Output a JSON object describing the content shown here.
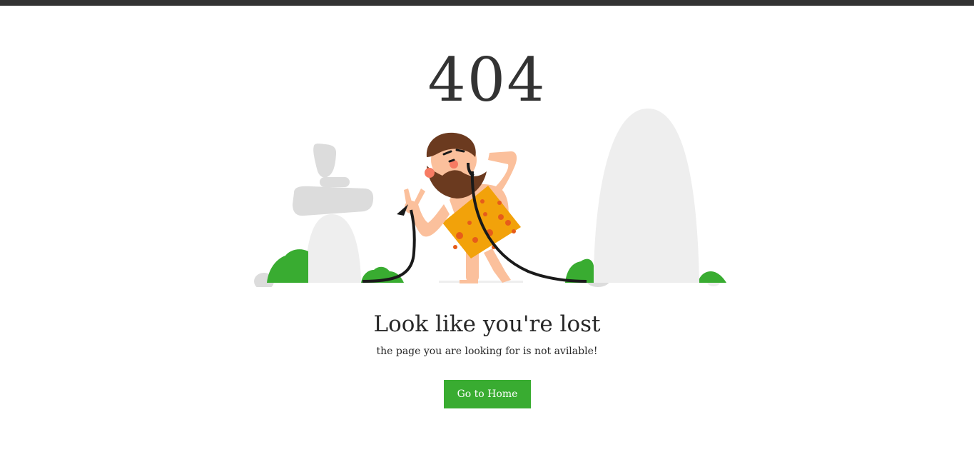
{
  "error": {
    "code": "404",
    "headline": "Look like you're lost",
    "message": "the page you are looking for is not avilable!"
  },
  "actions": {
    "home_label": "Go to Home"
  },
  "colors": {
    "top_bar": "#333333",
    "text": "#262626",
    "button": "#39ac31",
    "button_text": "#ffffff",
    "rock": "#eeeeee",
    "bush": "#39ac31",
    "loincloth": "#f2a20a"
  }
}
